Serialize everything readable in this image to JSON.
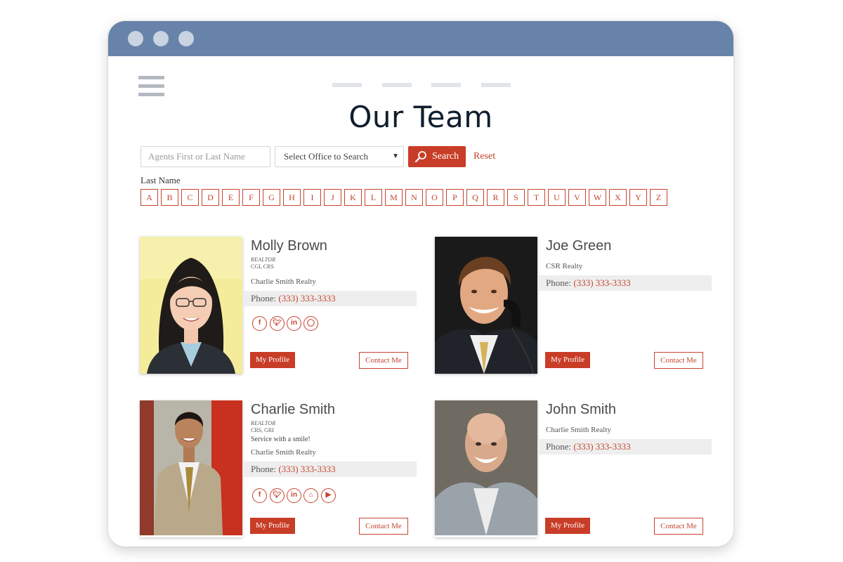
{
  "window": {
    "dots": [
      "window-dot-1",
      "window-dot-2",
      "window-dot-3"
    ]
  },
  "nav": {
    "menu_icon": "hamburger-icon"
  },
  "page": {
    "title": "Our Team"
  },
  "search": {
    "placeholder": "Agents First or Last Name",
    "office_select_value": "Select Office to Search",
    "search_label": "Search",
    "reset_label": "Reset"
  },
  "filter": {
    "label": "Last Name",
    "letters": [
      "A",
      "B",
      "C",
      "D",
      "E",
      "F",
      "G",
      "H",
      "I",
      "J",
      "K",
      "L",
      "M",
      "N",
      "O",
      "P",
      "Q",
      "R",
      "S",
      "T",
      "U",
      "V",
      "W",
      "X",
      "Y",
      "Z"
    ]
  },
  "agents": [
    {
      "name": "Molly Brown",
      "title": "REALTOR",
      "designations": "CGI, CRS",
      "tagline": "",
      "office": "Charlie Smith Realty",
      "phone_label": "Phone:",
      "phone": "(333) 333-3333",
      "socials": [
        "facebook-icon",
        "twitter-icon",
        "linkedin-icon",
        "instagram-icon"
      ],
      "profile_label": "My Profile",
      "contact_label": "Contact Me"
    },
    {
      "name": "Joe Green",
      "title": "",
      "designations": "",
      "tagline": "",
      "office": "CSR Realty",
      "phone_label": "Phone:",
      "phone": "(333) 333-3333",
      "socials": [],
      "profile_label": "My Profile",
      "contact_label": "Contact Me"
    },
    {
      "name": "Charlie Smith",
      "title": "REALTOR",
      "designations": "CRS, GRI",
      "tagline": "Service with a smile!",
      "office": "Charlie Smith Realty",
      "phone_label": "Phone:",
      "phone": "(333) 333-3333",
      "socials": [
        "facebook-icon",
        "twitter-icon",
        "linkedin-icon",
        "zillow-icon",
        "youtube-icon"
      ],
      "profile_label": "My Profile",
      "contact_label": "Contact Me"
    },
    {
      "name": "John Smith",
      "title": "",
      "designations": "",
      "tagline": "",
      "office": "Charlie Smith Realty",
      "phone_label": "Phone:",
      "phone": "(333) 333-3333",
      "socials": [],
      "profile_label": "My Profile",
      "contact_label": "Contact Me"
    }
  ],
  "colors": {
    "titlebar": "#6783a9",
    "accent": "#c83d27",
    "title_text": "#0f1e2c"
  }
}
